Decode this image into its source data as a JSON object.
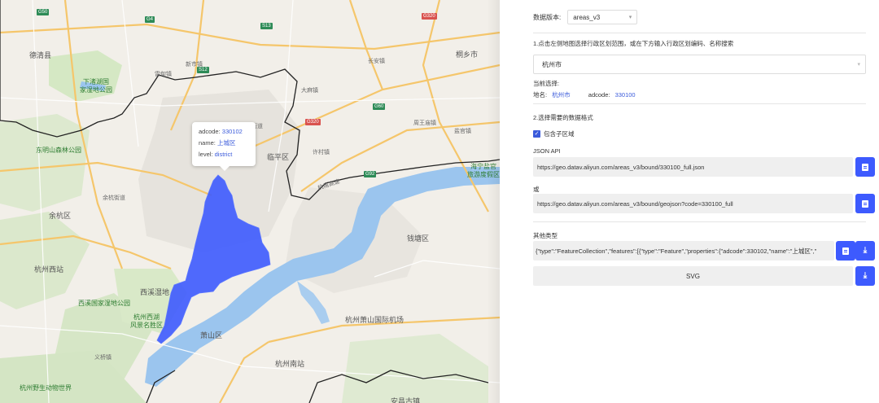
{
  "map": {
    "tooltip": {
      "adcode_label": "adcode:",
      "adcode_value": "330102",
      "name_label": "name:",
      "name_value": "上城区",
      "level_label": "level:",
      "level_value": "district"
    },
    "labels": {
      "l1": "德清县",
      "l2": "下渚湖国\n家湿地公园",
      "l3": "东明山森林公园",
      "l4": "杭州西站",
      "l5": "西溪湿地",
      "l6": "西溪国家湿地公园",
      "l7": "杭州西湖\n风景名胜区",
      "l8": "萧山区",
      "l9": "杭州南站",
      "l10": "杭州萧山国际机场",
      "l11": "海宁盐官\n旅游度假区",
      "l12": "临平区",
      "l13": "余杭区",
      "l14": "许村镇",
      "l15": "盐官镇",
      "l16": "杭州野生动物世界",
      "l17": "余杭街道",
      "l18": "大麻镇",
      "l19": "崇贤街道",
      "l20": "长安镇",
      "l21": "周王庙镇",
      "l22": "义桥镇",
      "l23": "安昌古镇",
      "l24": "新市镇",
      "l25": "桐乡市",
      "l26": "雷甸镇",
      "l27": "钱塘区",
      "l28": "杭甬高速"
    },
    "roads": {
      "g1": "G50",
      "g2": "G320",
      "g3": "G92",
      "g4": "G60",
      "g5": "S13",
      "g6": "G4",
      "g7": "S12"
    }
  },
  "panel": {
    "version_label": "数据版本:",
    "version_value": "areas_v3",
    "step1": "1.点击左侧地图选择行政区划范围，或在下方输入行政区划编码、名称搜索",
    "city_value": "杭州市",
    "current_label": "当前选择:",
    "place_label": "地名:",
    "place_value": "杭州市",
    "adcode_label": "adcode:",
    "adcode_value": "330100",
    "step2": "2.选择需要的数据格式",
    "include_sub_label": "包含子区域",
    "json_api_label": "JSON API",
    "json_api_url": "https://geo.datav.aliyun.com/areas_v3/bound/330100_full.json",
    "or_label": "或",
    "geojson_url": "https://geo.datav.aliyun.com/areas_v3/bound/geojson?code=330100_full",
    "other_types_label": "其他类型",
    "geojson_text": "{\"type\":\"FeatureCollection\",\"features\":[{\"type\":\"Feature\",\"properties\":{\"adcode\":330102,\"name\":\"上城区\",\"",
    "svg_label": "SVG"
  },
  "colors": {
    "accent": "#3d5afe",
    "selected_area": "#3d5afe",
    "water": "#9bc5ee"
  }
}
